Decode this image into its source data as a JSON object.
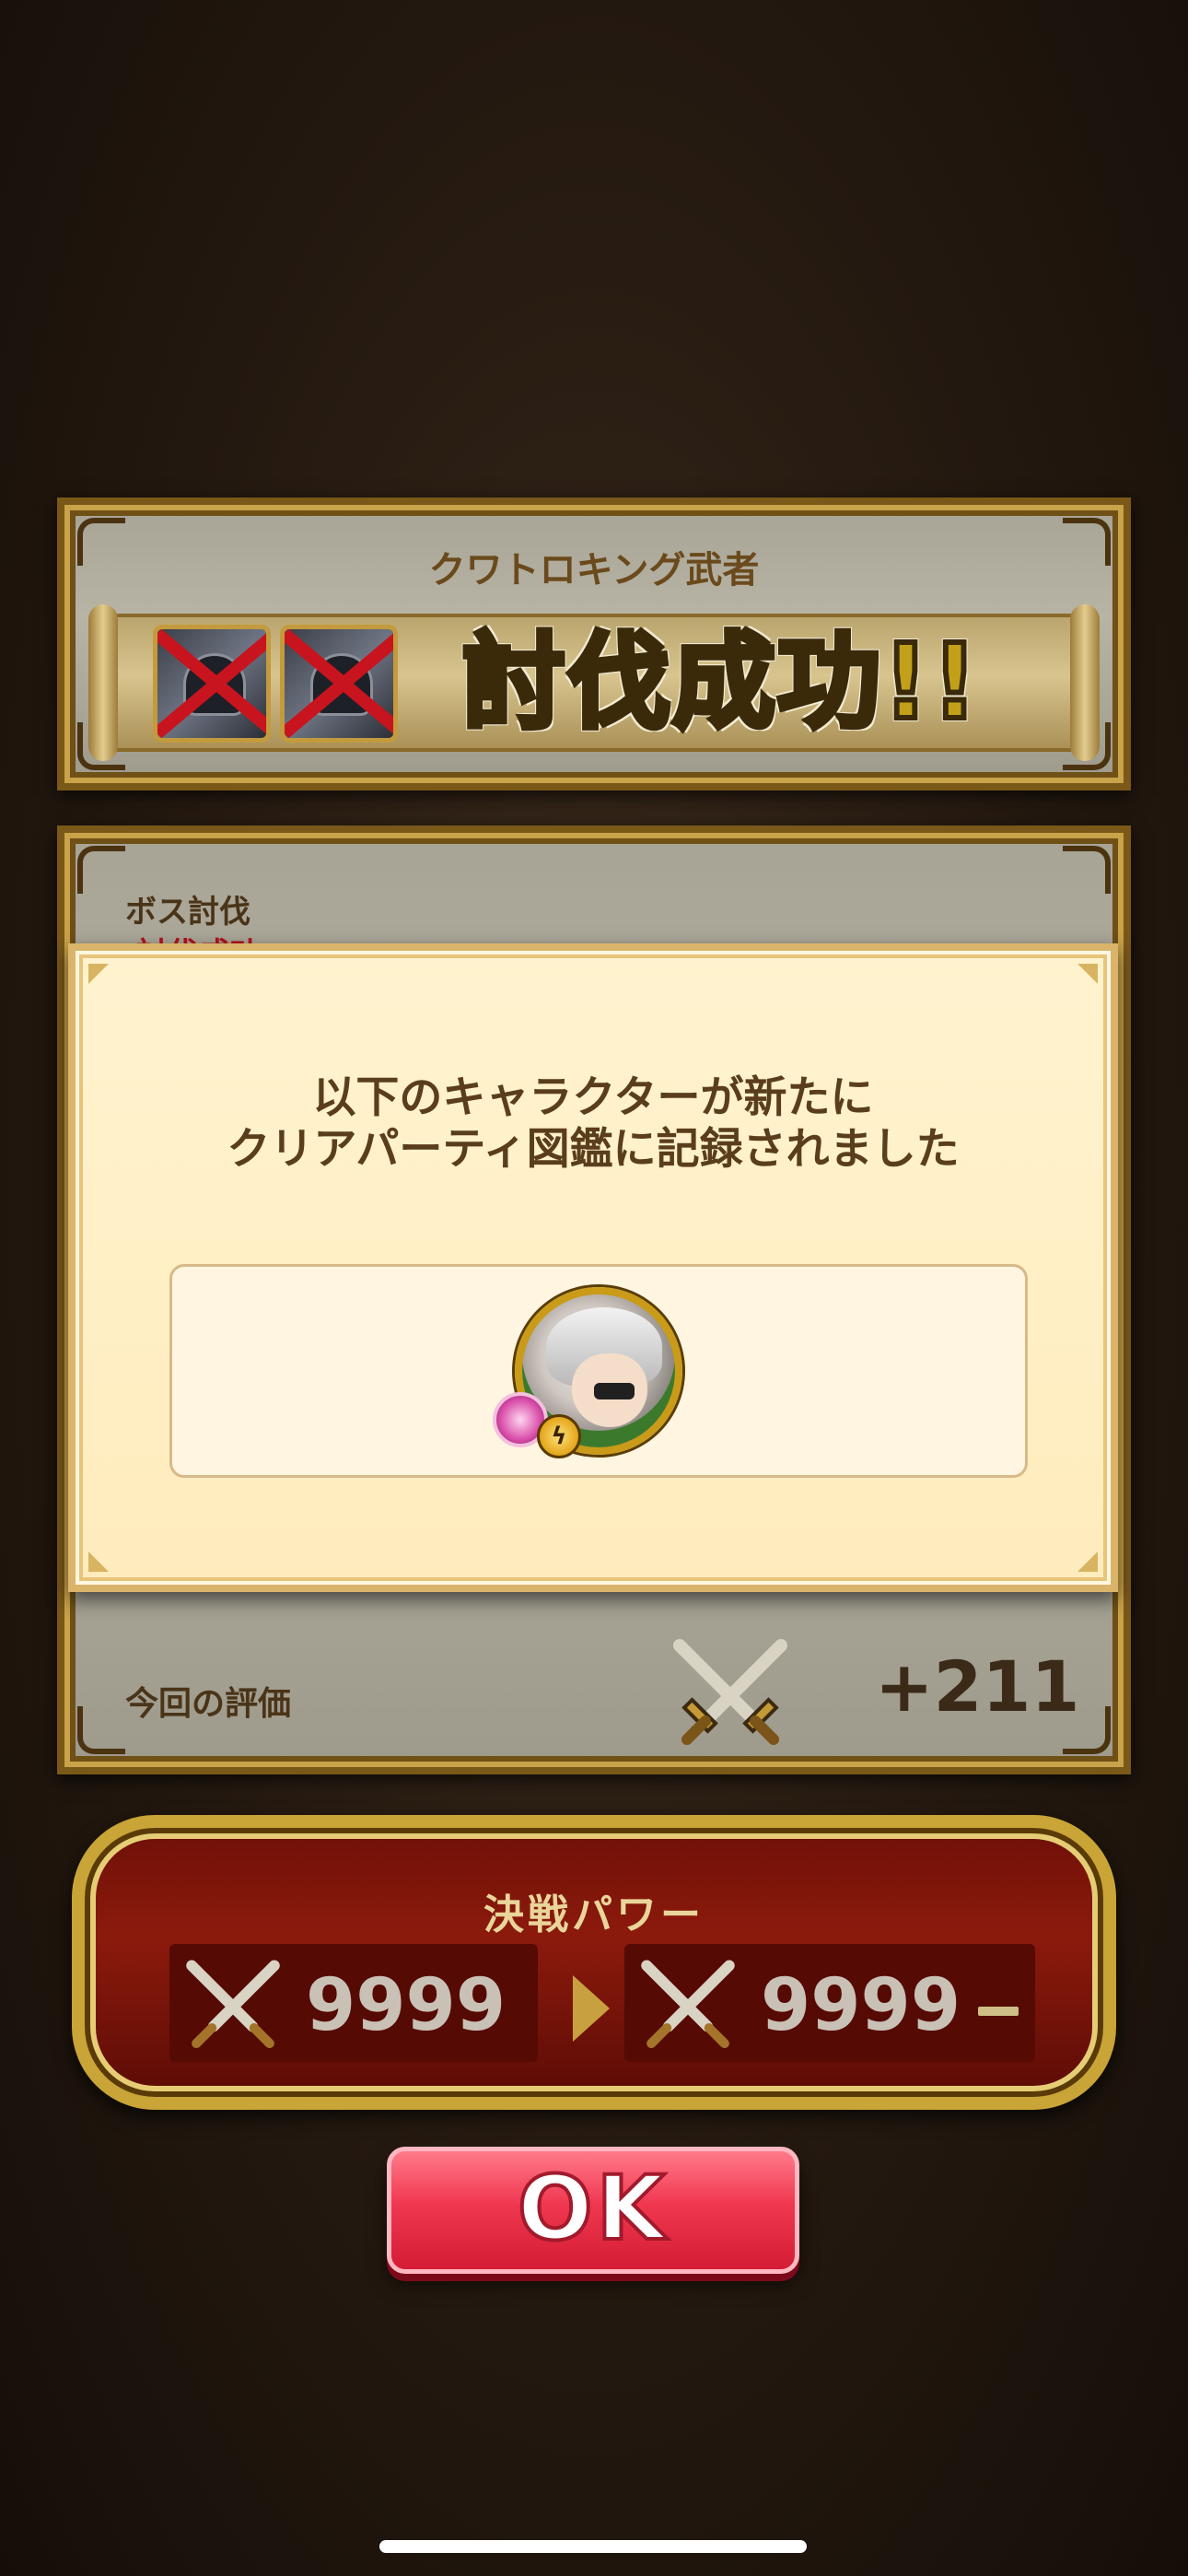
{
  "result_header": {
    "boss_name": "クワトロキング武者",
    "victory_text": "討伐成功!!"
  },
  "stats": {
    "boss_label": "ボス討伐",
    "boss_status": "討伐成功",
    "eval_label": "今回の評価",
    "eval_value": "+211"
  },
  "modal": {
    "message_line1": "以下のキャラクターが新たに",
    "message_line2": "クリアパーティ図鑑に記録されました"
  },
  "power": {
    "title": "決戦パワー",
    "before": "9999",
    "after": "9999"
  },
  "buttons": {
    "ok_label": "OK"
  },
  "icons": {
    "sword": "crossed-swords-icon",
    "arrow": "triangle-right-icon"
  }
}
